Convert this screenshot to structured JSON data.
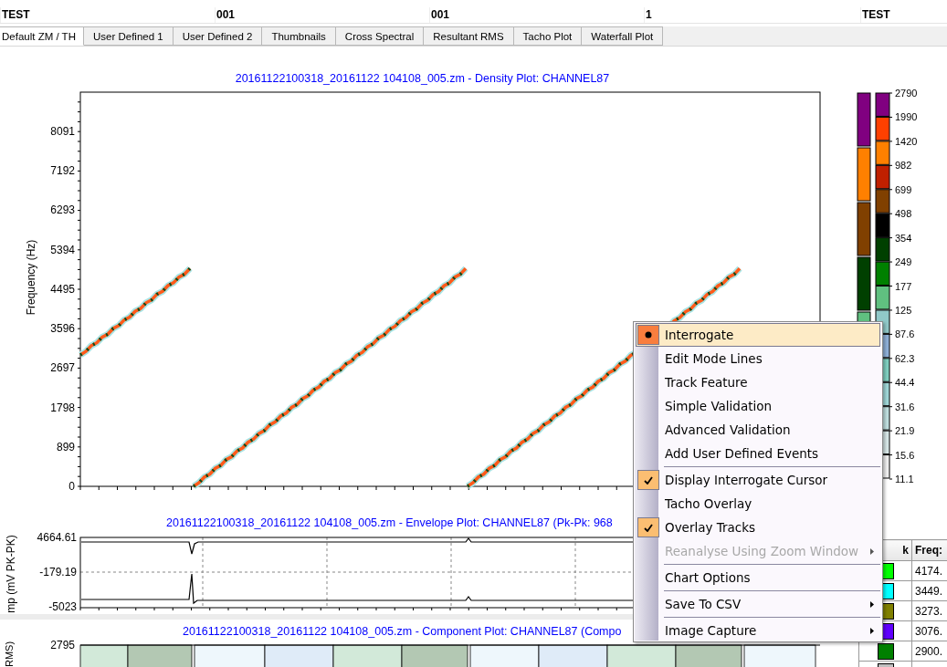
{
  "header": [
    "TEST",
    "001",
    "001",
    "1",
    "TEST"
  ],
  "tabs": [
    {
      "label": "Default ZM / TH",
      "selected": true
    },
    {
      "label": "User Defined 1",
      "selected": false
    },
    {
      "label": "User Defined 2",
      "selected": false
    },
    {
      "label": "Thumbnails",
      "selected": false
    },
    {
      "label": "Cross Spectral",
      "selected": false
    },
    {
      "label": "Resultant RMS",
      "selected": false
    },
    {
      "label": "Tacho Plot",
      "selected": false
    },
    {
      "label": "Waterfall Plot",
      "selected": false
    }
  ],
  "density_plot": {
    "title": "20161122100318_20161122 104108_005.zm - Density Plot: CHANNEL87",
    "ylabel": "Frequency (Hz)",
    "yticks": [
      "8091",
      "7192",
      "6293",
      "5394",
      "4495",
      "3596",
      "2697",
      "1798",
      "899",
      "0"
    ]
  },
  "color_scale": {
    "left_bar": [
      {
        "color": "#800080"
      },
      {
        "color": "#ff8000"
      },
      {
        "color": "#804000"
      },
      {
        "color": "#004000"
      },
      {
        "color": "#60c080"
      }
    ],
    "right_bar": [
      {
        "color": "#800080"
      },
      {
        "color": "#ff4000"
      },
      {
        "color": "#ff8000"
      },
      {
        "color": "#c02000"
      },
      {
        "color": "#804000"
      },
      {
        "color": "#000000"
      },
      {
        "color": "#004000"
      },
      {
        "color": "#008000"
      },
      {
        "color": "#60c080"
      },
      {
        "color": "#90c8c8"
      },
      {
        "color": "#90b0d8"
      },
      {
        "color": "#80d0c0"
      },
      {
        "color": "#a0d8d8"
      },
      {
        "color": "#c0e0e0"
      },
      {
        "color": "#d8e8e8"
      },
      {
        "color": "#f0f0f0"
      }
    ],
    "labels": [
      "2790",
      "1990",
      "1420",
      "982",
      "699",
      "498",
      "354",
      "249",
      "177",
      "125",
      "87.6",
      "62.3",
      "44.4",
      "31.6",
      "21.9",
      "15.6",
      "11.1"
    ]
  },
  "envelope_plot": {
    "title": "20161122100318_20161122 104108_005.zm  - Envelope Plot:  CHANNEL87 (Pk-Pk: 968",
    "ylabel": "mp (mV PK-PK)",
    "yticks": [
      "4664.61",
      "-179.19",
      "-5023"
    ]
  },
  "component_plot": {
    "title": "20161122100318_20161122 104108_005.zm - Component Plot: CHANNEL87 (Compo",
    "ylabel": "RMS)",
    "yticks": [
      "2795"
    ]
  },
  "track_table": {
    "columns": [
      "k",
      "Freq:"
    ],
    "rows": [
      {
        "color": "#00ff00",
        "freq": "4174."
      },
      {
        "color": "#00ffff",
        "freq": "3449."
      },
      {
        "color": "#808000",
        "freq": "3273."
      },
      {
        "color": "#6000ff",
        "freq": "3076."
      },
      {
        "color": "#008000",
        "freq": "2900."
      },
      {
        "color": "#c0c0c0"
      }
    ]
  },
  "context_menu": {
    "items": [
      {
        "kind": "radio",
        "label": "Interrogate",
        "checked": true,
        "selected": true,
        "disabled": false,
        "submenu": false
      },
      {
        "kind": "plain",
        "label": "Edit Mode Lines",
        "selected": false,
        "disabled": false,
        "submenu": false
      },
      {
        "kind": "plain",
        "label": "Track Feature",
        "selected": false,
        "disabled": false,
        "submenu": false
      },
      {
        "kind": "plain",
        "label": "Simple Validation",
        "selected": false,
        "disabled": false,
        "submenu": false
      },
      {
        "kind": "plain",
        "label": "Advanced Validation",
        "selected": false,
        "disabled": false,
        "submenu": false
      },
      {
        "kind": "plain",
        "label": "Add User Defined Events",
        "selected": false,
        "disabled": false,
        "submenu": false
      },
      {
        "kind": "separator"
      },
      {
        "kind": "check",
        "label": "Display Interrogate Cursor",
        "checked": true,
        "selected": false,
        "disabled": false,
        "submenu": false
      },
      {
        "kind": "check",
        "label": "Tacho Overlay",
        "checked": false,
        "selected": false,
        "disabled": false,
        "submenu": false
      },
      {
        "kind": "check",
        "label": "Overlay Tracks",
        "checked": true,
        "selected": false,
        "disabled": false,
        "submenu": false
      },
      {
        "kind": "plain",
        "label": "Reanalyse Using Zoom Window",
        "selected": false,
        "disabled": true,
        "submenu": true
      },
      {
        "kind": "separator"
      },
      {
        "kind": "plain",
        "label": "Chart Options",
        "selected": false,
        "disabled": false,
        "submenu": false
      },
      {
        "kind": "separator"
      },
      {
        "kind": "plain",
        "label": "Save To CSV",
        "selected": false,
        "disabled": false,
        "submenu": true
      },
      {
        "kind": "separator"
      },
      {
        "kind": "plain",
        "label": "Image Capture",
        "selected": false,
        "disabled": false,
        "submenu": true
      }
    ]
  }
}
